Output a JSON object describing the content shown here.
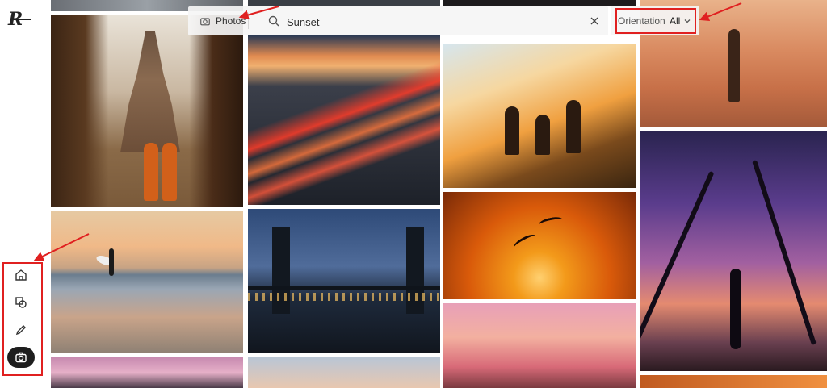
{
  "sidebar": {
    "logo": "R",
    "nav": [
      {
        "name": "home",
        "icon": "home-icon"
      },
      {
        "name": "shapes",
        "icon": "shapes-icon"
      },
      {
        "name": "edit",
        "icon": "pencil-icon"
      },
      {
        "name": "photos",
        "icon": "camera-icon",
        "active": true
      }
    ]
  },
  "search": {
    "category_label": "Photos",
    "category_icon": "camera-icon",
    "query": "Sunset",
    "clear_icon": "close-icon"
  },
  "filters": {
    "orientation_label": "Orientation",
    "orientation_value": "All"
  },
  "photos": [
    "temple-monks",
    "beach-surfer",
    "sunset-clouds",
    "city-highway-light-trails",
    "bridge-at-dusk",
    "sky-pastel",
    "friends-on-hill",
    "birds-at-sunset",
    "pink-sky-silhouette",
    "woman-in-water",
    "yoga-under-palms",
    "orange-horizon"
  ],
  "colors": {
    "annotation": "#e02020",
    "active_nav": "#1e1e1e"
  }
}
